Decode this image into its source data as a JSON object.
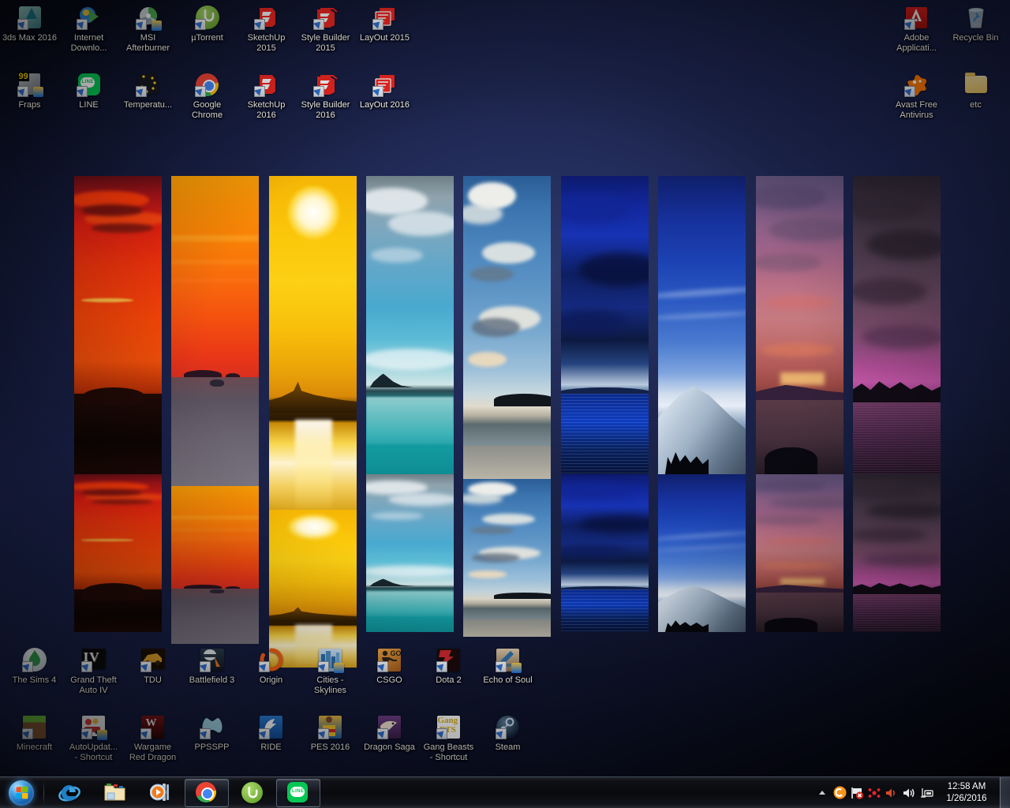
{
  "desktop": {
    "wallpaper": {
      "name": "sunset-to-night-panel-collage",
      "panels": [
        {
          "name": "red-sunset-clouds",
          "accent": "#f5500a"
        },
        {
          "name": "orange-sunset-sea",
          "accent": "#f9690c"
        },
        {
          "name": "golden-sun-over-sea",
          "accent": "#fcd014"
        },
        {
          "name": "turquoise-bay-islet",
          "accent": "#16a2a8"
        },
        {
          "name": "blue-sky-cumulus-beach",
          "accent": "#4c86bd"
        },
        {
          "name": "deep-blue-stormy-sea",
          "accent": "#1733b4"
        },
        {
          "name": "snow-mountain-blue-sky",
          "accent": "#2b59c2"
        },
        {
          "name": "pink-dusk-lake",
          "accent": "#c07487"
        },
        {
          "name": "purple-night-lake",
          "accent": "#cc5bb0"
        }
      ]
    },
    "icons_top_left": [
      {
        "label": "3ds Max 2016",
        "icon": "3ds-max-icon",
        "shortcut": true
      },
      {
        "label": "Internet\nDownlo...",
        "icon": "internet-download-manager-icon",
        "shortcut": true
      },
      {
        "label": "MSI\nAfterburner",
        "icon": "msi-afterburner-icon",
        "shortcut": true
      },
      {
        "label": "µTorrent",
        "icon": "utorrent-icon",
        "shortcut": true
      },
      {
        "label": "SketchUp\n2015",
        "icon": "sketchup-icon",
        "shortcut": true
      },
      {
        "label": "Style Builder\n2015",
        "icon": "style-builder-icon",
        "shortcut": true
      },
      {
        "label": "LayOut 2015",
        "icon": "layout-icon",
        "shortcut": true
      },
      {
        "label": "Fraps",
        "icon": "fraps-icon",
        "shortcut": true
      },
      {
        "label": "LINE",
        "icon": "line-icon",
        "shortcut": true
      },
      {
        "label": "Temperatu...",
        "icon": "temperature-icon",
        "shortcut": true
      },
      {
        "label": "Google\nChrome",
        "icon": "google-chrome-icon",
        "shortcut": true
      },
      {
        "label": "SketchUp\n2016",
        "icon": "sketchup-icon",
        "shortcut": true
      },
      {
        "label": "Style Builder\n2016",
        "icon": "style-builder-icon",
        "shortcut": true
      },
      {
        "label": "LayOut 2016",
        "icon": "layout-icon",
        "shortcut": true
      }
    ],
    "icons_top_right": [
      {
        "label": "Adobe\nApplicati...",
        "icon": "adobe-icon",
        "shortcut": true
      },
      {
        "label": "Recycle Bin",
        "icon": "recycle-bin-icon",
        "shortcut": false
      },
      {
        "label": "Avast Free\nAntivirus",
        "icon": "avast-icon",
        "shortcut": true
      },
      {
        "label": "etc",
        "icon": "folder-icon",
        "shortcut": false
      }
    ],
    "icons_bottom": [
      {
        "label": "The Sims 4",
        "icon": "the-sims-4-icon",
        "shortcut": true
      },
      {
        "label": "Grand Theft\nAuto IV",
        "icon": "gta-iv-icon",
        "shortcut": true
      },
      {
        "label": "TDU",
        "icon": "tdu-icon",
        "shortcut": true
      },
      {
        "label": "Battlefield 3",
        "icon": "battlefield-3-icon",
        "shortcut": true
      },
      {
        "label": "Origin",
        "icon": "origin-icon",
        "shortcut": true
      },
      {
        "label": "Cities -\nSkylines",
        "icon": "cities-skylines-icon",
        "shortcut": true
      },
      {
        "label": "CSGO",
        "icon": "csgo-icon",
        "shortcut": true
      },
      {
        "label": "Dota 2",
        "icon": "dota-2-icon",
        "shortcut": true
      },
      {
        "label": "Echo of Soul",
        "icon": "echo-of-soul-icon",
        "shortcut": true
      },
      {
        "label": "Minecraft",
        "icon": "minecraft-icon",
        "shortcut": true
      },
      {
        "label": "AutoUpdat...\n- Shortcut",
        "icon": "autoupdater-icon",
        "shortcut": true
      },
      {
        "label": "Wargame\nRed Dragon",
        "icon": "wargame-red-dragon-icon",
        "shortcut": true
      },
      {
        "label": "PPSSPP",
        "icon": "ppsspp-icon",
        "shortcut": true
      },
      {
        "label": "RIDE",
        "icon": "ride-icon",
        "shortcut": true
      },
      {
        "label": "PES 2016",
        "icon": "pes-2016-icon",
        "shortcut": true
      },
      {
        "label": "Dragon Saga",
        "icon": "dragon-saga-icon",
        "shortcut": true
      },
      {
        "label": "Gang Beasts\n- Shortcut",
        "icon": "gang-beasts-icon",
        "shortcut": true
      },
      {
        "label": "Steam",
        "icon": "steam-icon",
        "shortcut": true
      }
    ]
  },
  "taskbar": {
    "start_button": {
      "label": "Start",
      "icon": "windows-orb-icon"
    },
    "pinned": [
      {
        "label": "Internet Explorer",
        "icon": "internet-explorer-icon",
        "running": false
      },
      {
        "label": "Windows Explorer",
        "icon": "windows-explorer-icon",
        "running": false
      },
      {
        "label": "Windows Media Player",
        "icon": "windows-media-player-icon",
        "running": false
      },
      {
        "label": "Google Chrome",
        "icon": "google-chrome-icon",
        "running": true
      },
      {
        "label": "µTorrent",
        "icon": "utorrent-icon",
        "running": false
      },
      {
        "label": "LINE",
        "icon": "line-icon",
        "running": true
      }
    ],
    "tray": {
      "show_hidden_icons": {
        "label": "Show hidden icons",
        "icon": "chevron-up-icon"
      },
      "icons": [
        {
          "label": "Avast Antivirus",
          "icon": "avast-tray-icon",
          "color": "#f7941d"
        },
        {
          "label": "Action Center",
          "icon": "flag-error-icon",
          "color": "#e8e8e8"
        },
        {
          "label": "AMD Catalyst",
          "icon": "amd-catalyst-icon",
          "color": "#e8232a"
        },
        {
          "label": "Volume muted",
          "icon": "speaker-muted-icon",
          "color": "#d94a2a"
        },
        {
          "label": "Volume",
          "icon": "speaker-icon",
          "color": "#e8e8e8"
        },
        {
          "label": "Network",
          "icon": "network-icon",
          "color": "#dcdcdc"
        }
      ],
      "clock": {
        "time": "12:58 AM",
        "date": "1/26/2016"
      },
      "show_desktop": {
        "label": "Show desktop"
      }
    }
  }
}
